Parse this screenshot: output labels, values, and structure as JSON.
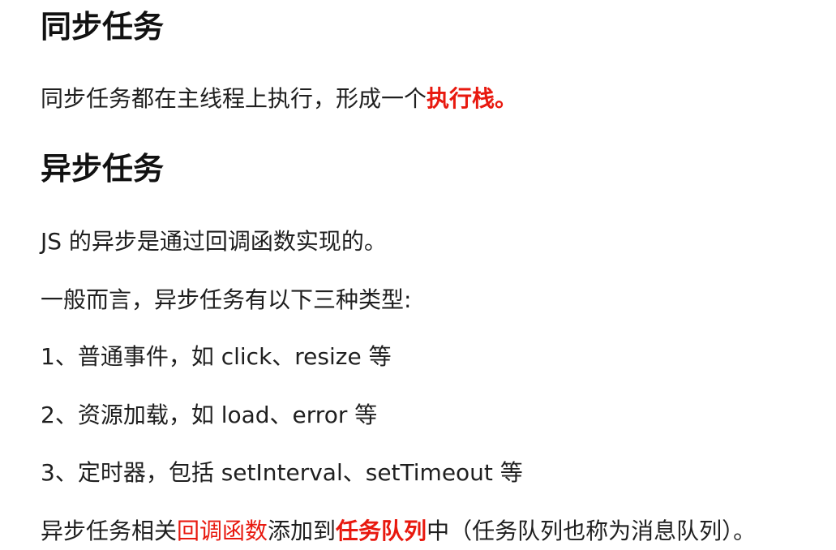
{
  "sync": {
    "heading": "同步任务",
    "para_prefix": "同步任务都在主线程上执行，形成一个",
    "para_highlight": "执行栈。"
  },
  "async": {
    "heading": "异步任务",
    "line1": "JS 的异步是通过回调函数实现的。",
    "line2": "一般而言，异步任务有以下三种类型:",
    "item1": "1、普通事件，如 click、resize 等",
    "item2": "2、资源加载，如 load、error 等",
    "item3": "3、定时器，包括 setInterval、setTimeout 等",
    "final": {
      "part1": "异步任务相关",
      "highlight1": "回调函数",
      "part2": "添加到",
      "highlight2": "任务队列",
      "part3": "中（任务队列也称为消息队列）。"
    }
  },
  "colors": {
    "highlight": "#e8190f",
    "text": "#1f1f1f"
  }
}
